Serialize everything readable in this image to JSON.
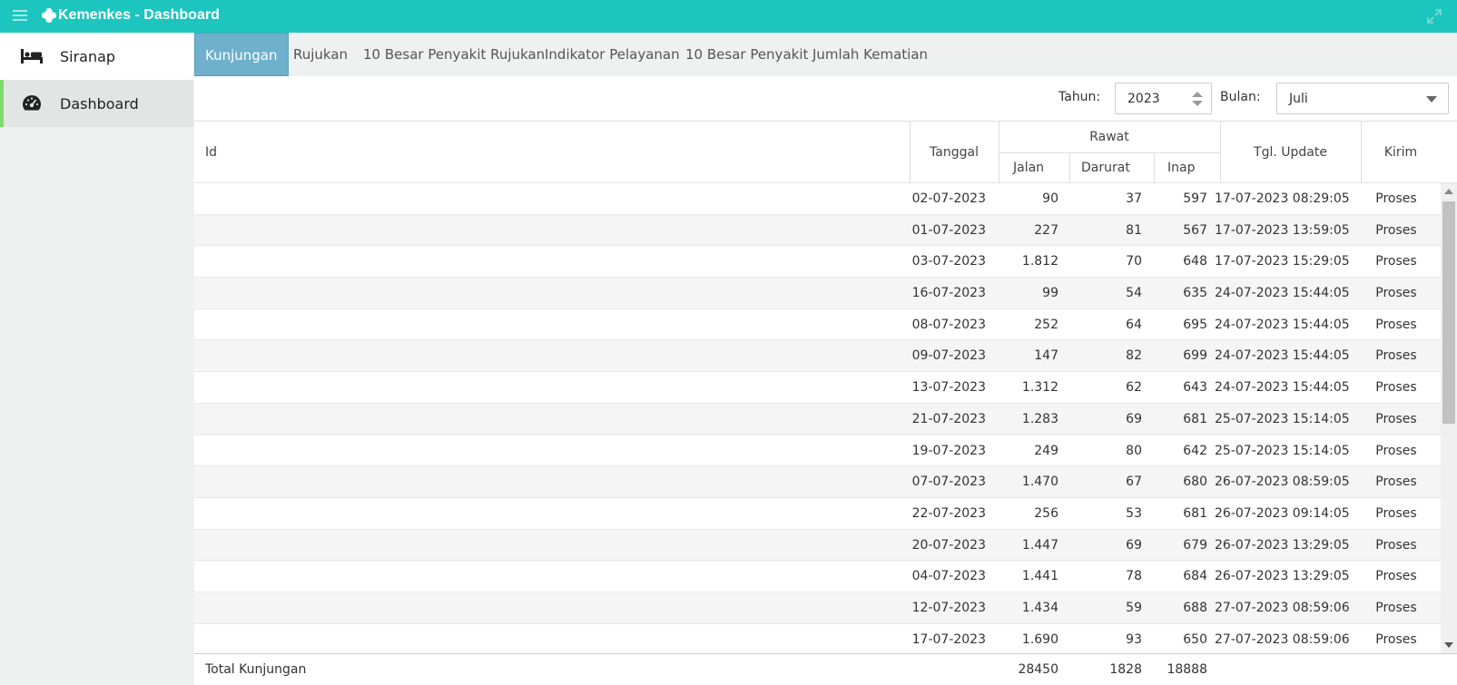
{
  "app": {
    "title": "Kemenkes - Dashboard"
  },
  "sidebar": {
    "items": [
      {
        "label": "Siranap",
        "icon": "bed-icon"
      },
      {
        "label": "Dashboard",
        "icon": "speedometer-icon"
      }
    ]
  },
  "tabs": [
    {
      "label": "Kunjungan",
      "active": true
    },
    {
      "label": "Rujukan"
    },
    {
      "label": "10 Besar Penyakit Rujukan"
    },
    {
      "label": "Indikator Pelayanan"
    },
    {
      "label": "10 Besar Penyakit"
    },
    {
      "label": "Jumlah Kematian"
    }
  ],
  "filters": {
    "year_label": "Tahun:",
    "year_value": "2023",
    "month_label": "Bulan:",
    "month_value": "Juli"
  },
  "table": {
    "headers": {
      "id": "Id",
      "tanggal": "Tanggal",
      "rawat": "Rawat",
      "jalan": "Jalan",
      "darurat": "Darurat",
      "inap": "Inap",
      "tgl_update": "Tgl. Update",
      "kirim": "Kirim"
    },
    "rows": [
      {
        "tanggal": "02-07-2023",
        "jalan": "90",
        "darurat": "37",
        "inap": "597",
        "tgl_update": "17-07-2023 08:29:05",
        "kirim": "Proses"
      },
      {
        "tanggal": "01-07-2023",
        "jalan": "227",
        "darurat": "81",
        "inap": "567",
        "tgl_update": "17-07-2023 13:59:05",
        "kirim": "Proses"
      },
      {
        "tanggal": "03-07-2023",
        "jalan": "1.812",
        "darurat": "70",
        "inap": "648",
        "tgl_update": "17-07-2023 15:29:05",
        "kirim": "Proses"
      },
      {
        "tanggal": "16-07-2023",
        "jalan": "99",
        "darurat": "54",
        "inap": "635",
        "tgl_update": "24-07-2023 15:44:05",
        "kirim": "Proses"
      },
      {
        "tanggal": "08-07-2023",
        "jalan": "252",
        "darurat": "64",
        "inap": "695",
        "tgl_update": "24-07-2023 15:44:05",
        "kirim": "Proses"
      },
      {
        "tanggal": "09-07-2023",
        "jalan": "147",
        "darurat": "82",
        "inap": "699",
        "tgl_update": "24-07-2023 15:44:05",
        "kirim": "Proses"
      },
      {
        "tanggal": "13-07-2023",
        "jalan": "1.312",
        "darurat": "62",
        "inap": "643",
        "tgl_update": "24-07-2023 15:44:05",
        "kirim": "Proses"
      },
      {
        "tanggal": "21-07-2023",
        "jalan": "1.283",
        "darurat": "69",
        "inap": "681",
        "tgl_update": "25-07-2023 15:14:05",
        "kirim": "Proses"
      },
      {
        "tanggal": "19-07-2023",
        "jalan": "249",
        "darurat": "80",
        "inap": "642",
        "tgl_update": "25-07-2023 15:14:05",
        "kirim": "Proses"
      },
      {
        "tanggal": "07-07-2023",
        "jalan": "1.470",
        "darurat": "67",
        "inap": "680",
        "tgl_update": "26-07-2023 08:59:05",
        "kirim": "Proses"
      },
      {
        "tanggal": "22-07-2023",
        "jalan": "256",
        "darurat": "53",
        "inap": "681",
        "tgl_update": "26-07-2023 09:14:05",
        "kirim": "Proses"
      },
      {
        "tanggal": "20-07-2023",
        "jalan": "1.447",
        "darurat": "69",
        "inap": "679",
        "tgl_update": "26-07-2023 13:29:05",
        "kirim": "Proses"
      },
      {
        "tanggal": "04-07-2023",
        "jalan": "1.441",
        "darurat": "78",
        "inap": "684",
        "tgl_update": "26-07-2023 13:29:05",
        "kirim": "Proses"
      },
      {
        "tanggal": "12-07-2023",
        "jalan": "1.434",
        "darurat": "59",
        "inap": "688",
        "tgl_update": "27-07-2023 08:59:06",
        "kirim": "Proses"
      },
      {
        "tanggal": "17-07-2023",
        "jalan": "1.690",
        "darurat": "93",
        "inap": "650",
        "tgl_update": "27-07-2023 08:59:06",
        "kirim": "Proses"
      }
    ],
    "footer": {
      "label": "Total Kunjungan",
      "jalan": "28450",
      "darurat": "1828",
      "inap": "18888"
    }
  },
  "colors": {
    "topbar": "#1dc5bf",
    "active_tab": "#6fb0cc",
    "sidebar_active_accent": "#7ddc6a"
  }
}
